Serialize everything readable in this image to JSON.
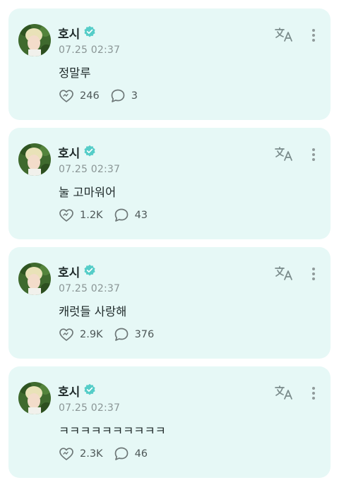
{
  "posts": [
    {
      "author": "호시",
      "time": "07.25 02:37",
      "text": "정말루",
      "likes": "246",
      "comments": "3"
    },
    {
      "author": "호시",
      "time": "07.25 02:37",
      "text": "눌 고마워어",
      "likes": "1.2K",
      "comments": "43"
    },
    {
      "author": "호시",
      "time": "07.25 02:37",
      "text": "캐럿들 사랑해",
      "likes": "2.9K",
      "comments": "376"
    },
    {
      "author": "호시",
      "time": "07.25 02:37",
      "text": "ㅋㅋㅋㅋㅋㅋㅋㅋㅋㅋ",
      "likes": "2.3K",
      "comments": "46"
    }
  ],
  "colors": {
    "card_bg": "#e6f8f6",
    "accent": "#55cdc8",
    "text": "#1f2a2a",
    "muted": "#8a9595"
  },
  "icons": {
    "verified": "verified-badge-icon",
    "translate": "translate-icon",
    "more": "more-vertical-icon",
    "like": "heart-like-icon",
    "comment": "comment-bubble-icon"
  }
}
